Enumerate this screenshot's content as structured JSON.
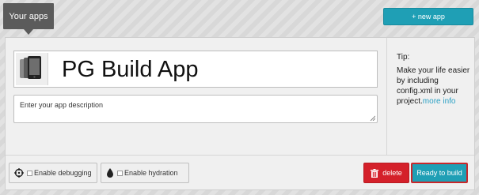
{
  "header": {
    "tab_label": "Your apps",
    "new_app_label": "+ new app"
  },
  "app": {
    "name": "PG Build App",
    "description_placeholder": "Enter your app description",
    "description_value": "",
    "icon": "phone-stack-icon"
  },
  "tip": {
    "heading": "Tip:",
    "body": "Make your life easier by including config.xml in your project.",
    "link": "more info"
  },
  "options": {
    "debugging_label": "Enable debugging",
    "debugging_checked": false,
    "hydration_label": "Enable hydration",
    "hydration_checked": false
  },
  "actions": {
    "delete_label": "delete",
    "ready_label": "Ready to build"
  },
  "colors": {
    "accent": "#1f9fb5",
    "danger": "#d4202a",
    "tab_bg": "#5b5b5b",
    "highlight_border": "#c9272a"
  }
}
